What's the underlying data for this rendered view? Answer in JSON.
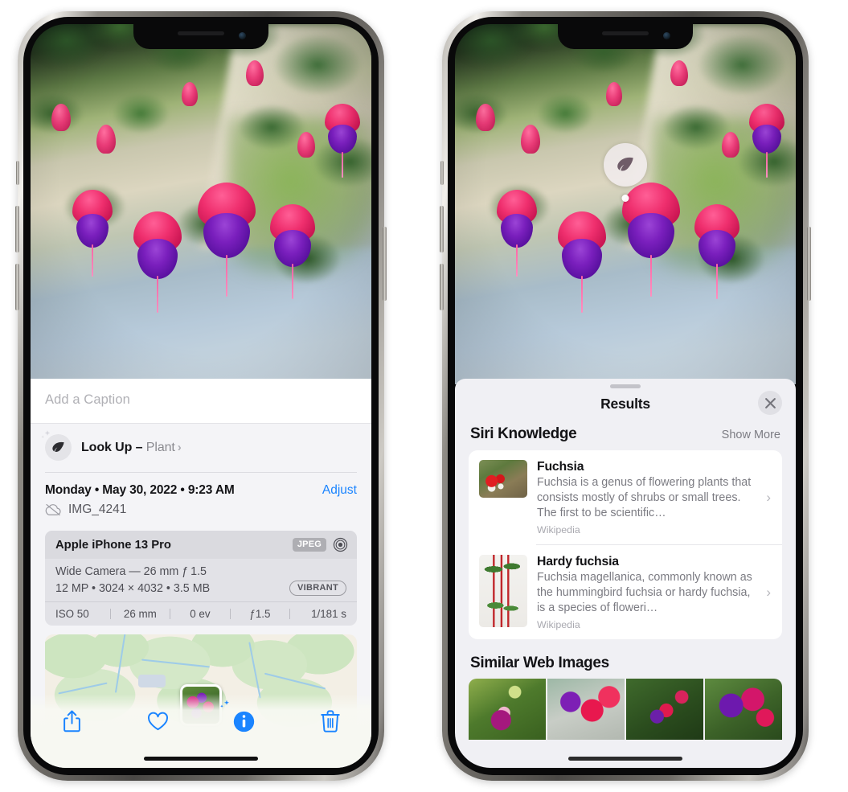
{
  "left_phone": {
    "caption": {
      "placeholder": "Add a Caption",
      "value": ""
    },
    "lookup": {
      "label": "Look Up – ",
      "subject": "Plant",
      "chevron": "›",
      "icon": "leaf-icon"
    },
    "info": {
      "date": "Monday • May 30, 2022 • 9:23 AM",
      "adjust_label": "Adjust",
      "filename": "IMG_4241",
      "cloud_icon": "icloud-slash-icon"
    },
    "exif": {
      "model": "Apple iPhone 13 Pro",
      "format_badge": "JPEG",
      "aperture_icon": "aperture-icon",
      "lens": "Wide Camera — 26 mm ƒ 1.5",
      "size_line": "12 MP • 3024 × 4032 • 3.5 MB",
      "style_badge": "VIBRANT",
      "stats": [
        "ISO 50",
        "26 mm",
        "0 ev",
        "ƒ1.5",
        "1/181 s"
      ]
    },
    "map": {
      "name": "photo-location-map"
    },
    "toolbar": [
      {
        "name": "share-button",
        "icon": "share-icon"
      },
      {
        "name": "favorite-button",
        "icon": "heart-icon"
      },
      {
        "name": "info-button",
        "icon": "info-sparkle-icon"
      },
      {
        "name": "delete-button",
        "icon": "trash-icon"
      }
    ]
  },
  "right_phone": {
    "badge": {
      "icon": "leaf-icon",
      "name": "visual-lookup-badge"
    },
    "sheet": {
      "title": "Results",
      "close_icon": "close-icon"
    },
    "siri_knowledge": {
      "title": "Siri Knowledge",
      "action": "Show More",
      "items": [
        {
          "title": "Fuchsia",
          "description": "Fuchsia is a genus of flowering plants that consists mostly of shrubs or small trees. The first to be scientific…",
          "source": "Wikipedia",
          "thumb": "fuchsia-red-flowers-thumb"
        },
        {
          "title": "Hardy fuchsia",
          "description": "Fuchsia magellanica, commonly known as the hummingbird fuchsia or hardy fuchsia, is a species of floweri…",
          "source": "Wikipedia",
          "thumb": "hardy-fuchsia-branch-thumb"
        }
      ]
    },
    "similar_web_images": {
      "title": "Similar Web Images",
      "items": [
        {
          "name": "web-image-1"
        },
        {
          "name": "web-image-2"
        },
        {
          "name": "web-image-3"
        },
        {
          "name": "web-image-4"
        }
      ]
    }
  },
  "colors": {
    "accent_blue": "#1a84ff",
    "sheet_bg": "#f4f4f7",
    "results_bg": "#f0f0f4",
    "card_white": "#ffffff",
    "secondary_text": "#7b7b82"
  }
}
